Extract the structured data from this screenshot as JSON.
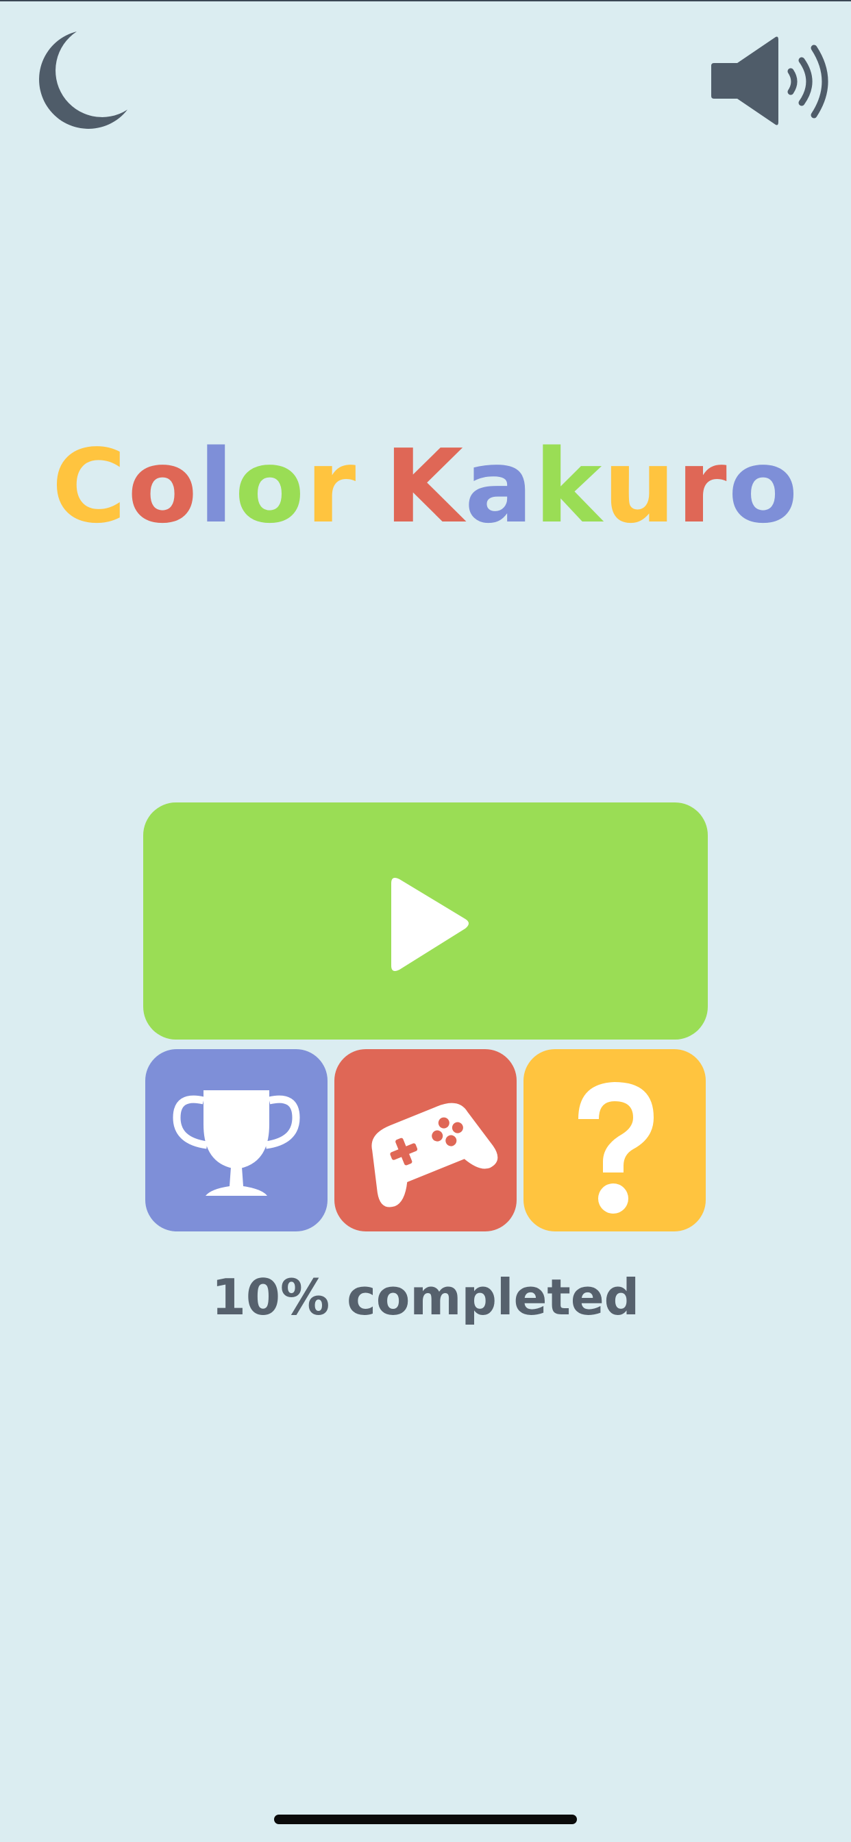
{
  "app": {
    "title_letters": [
      {
        "char": "C",
        "color": "#ffc43f"
      },
      {
        "char": "o",
        "color": "#df6756"
      },
      {
        "char": "l",
        "color": "#7e8fd8"
      },
      {
        "char": "o",
        "color": "#9add55"
      },
      {
        "char": "r",
        "color": "#ffc43f"
      },
      {
        "char": " ",
        "color": "#ffffff"
      },
      {
        "char": "K",
        "color": "#df6756"
      },
      {
        "char": "a",
        "color": "#7e8fd8"
      },
      {
        "char": "k",
        "color": "#9add55"
      },
      {
        "char": "u",
        "color": "#ffc43f"
      },
      {
        "char": "r",
        "color": "#df6756"
      },
      {
        "char": "o",
        "color": "#7e8fd8"
      }
    ]
  },
  "header": {
    "left_icon": "moon-icon",
    "right_icon": "speaker-volume-icon"
  },
  "menu": {
    "play_icon": "play-icon",
    "tiles": [
      {
        "name": "achievements",
        "icon": "trophy-icon",
        "color": "#7e8fd8"
      },
      {
        "name": "games",
        "icon": "gamepad-icon",
        "color": "#df6756"
      },
      {
        "name": "help",
        "icon": "question-icon",
        "color": "#ffc43f"
      }
    ],
    "play_color": "#9add55"
  },
  "progress": {
    "text": "10% completed",
    "percent": 10
  },
  "theme": {
    "background": "#dbedf1",
    "icon_color": "#4f5c69",
    "text_color": "#56616d"
  }
}
